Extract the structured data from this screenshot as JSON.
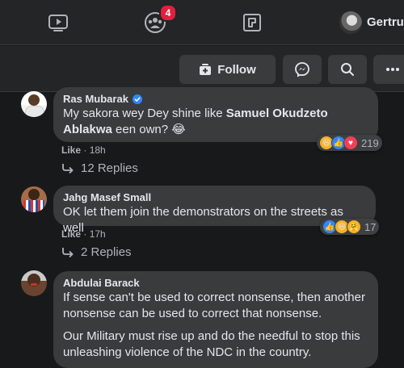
{
  "nav": {
    "notification_count": "4",
    "profile_name": "Gertrud"
  },
  "actions": {
    "follow_label": "Follow"
  },
  "comments": [
    {
      "author": "Ras Mubarak",
      "verified": true,
      "text_before": "My sakora wey Dey shine like ",
      "text_bold": "Samuel Okudzeto Ablakwa",
      "text_after": " een own? 😂",
      "like_label": "Like",
      "separator": " · ",
      "time": "18h",
      "reaction_count": "219",
      "replies_label": "12 Replies"
    },
    {
      "author": "Jahg Masef Small",
      "text": "OK let them join the demonstrators on the streets as well",
      "like_label": "Like",
      "separator": " · ",
      "time": "17h",
      "reaction_count": "17",
      "replies_label": "2 Replies"
    },
    {
      "author": "Abdulai Barack",
      "paragraph1": "If sense can't be used to correct nonsense, then another nonsense can be used to correct that nonsense.",
      "paragraph2": "Our Military must rise up and do the needful to stop this unleashing violence of the NDC in the country."
    }
  ],
  "colors": {
    "background": "#18191a",
    "surface": "#242526",
    "bubble": "#3a3b3c",
    "accent_blue": "#2d88ff",
    "badge_red": "#e41e3f"
  }
}
